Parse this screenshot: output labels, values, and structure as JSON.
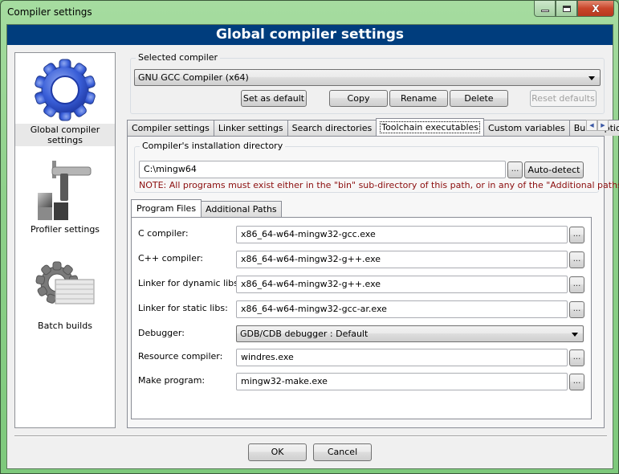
{
  "window": {
    "title": "Compiler settings",
    "controls": {
      "minimize": "minimize",
      "maximize": "maximize",
      "close": "X"
    }
  },
  "header": {
    "title": "Global compiler settings"
  },
  "sidebar": {
    "items": [
      {
        "label": "Global compiler settings",
        "icon": "gear-icon",
        "selected": true
      },
      {
        "label": "Profiler settings",
        "icon": "caliper-icon",
        "selected": false
      },
      {
        "label": "Batch builds",
        "icon": "batch-gear-icon",
        "selected": false
      }
    ]
  },
  "selected_compiler": {
    "legend": "Selected compiler",
    "value": "GNU GCC Compiler (x64)",
    "buttons": {
      "set_default": "Set as default",
      "copy": "Copy",
      "rename": "Rename",
      "delete": "Delete",
      "reset_defaults": "Reset defaults"
    }
  },
  "tabs": [
    {
      "label": "Compiler settings",
      "active": false
    },
    {
      "label": "Linker settings",
      "active": false
    },
    {
      "label": "Search directories",
      "active": false
    },
    {
      "label": "Toolchain executables",
      "active": true
    },
    {
      "label": "Custom variables",
      "active": false
    },
    {
      "label": "Build options",
      "active": false
    }
  ],
  "tab_scroll": {
    "left": "◀",
    "right": "▶"
  },
  "install_dir": {
    "legend": "Compiler's installation directory",
    "value": "C:\\mingw64",
    "browse": "...",
    "auto_detect": "Auto-detect",
    "note": "NOTE: All programs must exist either in the \"bin\" sub-directory of this path, or in any of the \"Additional paths\"..."
  },
  "subtabs": [
    {
      "label": "Program Files",
      "active": true
    },
    {
      "label": "Additional Paths",
      "active": false
    }
  ],
  "programs": {
    "browse_label": "...",
    "rows": [
      {
        "label": "C compiler:",
        "value": "x86_64-w64-mingw32-gcc.exe",
        "type": "text"
      },
      {
        "label": "C++ compiler:",
        "value": "x86_64-w64-mingw32-g++.exe",
        "type": "text"
      },
      {
        "label": "Linker for dynamic libs:",
        "value": "x86_64-w64-mingw32-g++.exe",
        "type": "text"
      },
      {
        "label": "Linker for static libs:",
        "value": "x86_64-w64-mingw32-gcc-ar.exe",
        "type": "text"
      },
      {
        "label": "Debugger:",
        "value": "GDB/CDB debugger : Default",
        "type": "select"
      },
      {
        "label": "Resource compiler:",
        "value": "windres.exe",
        "type": "text"
      },
      {
        "label": "Make program:",
        "value": "mingw32-make.exe",
        "type": "text"
      }
    ]
  },
  "footer": {
    "ok": "OK",
    "cancel": "Cancel"
  }
}
